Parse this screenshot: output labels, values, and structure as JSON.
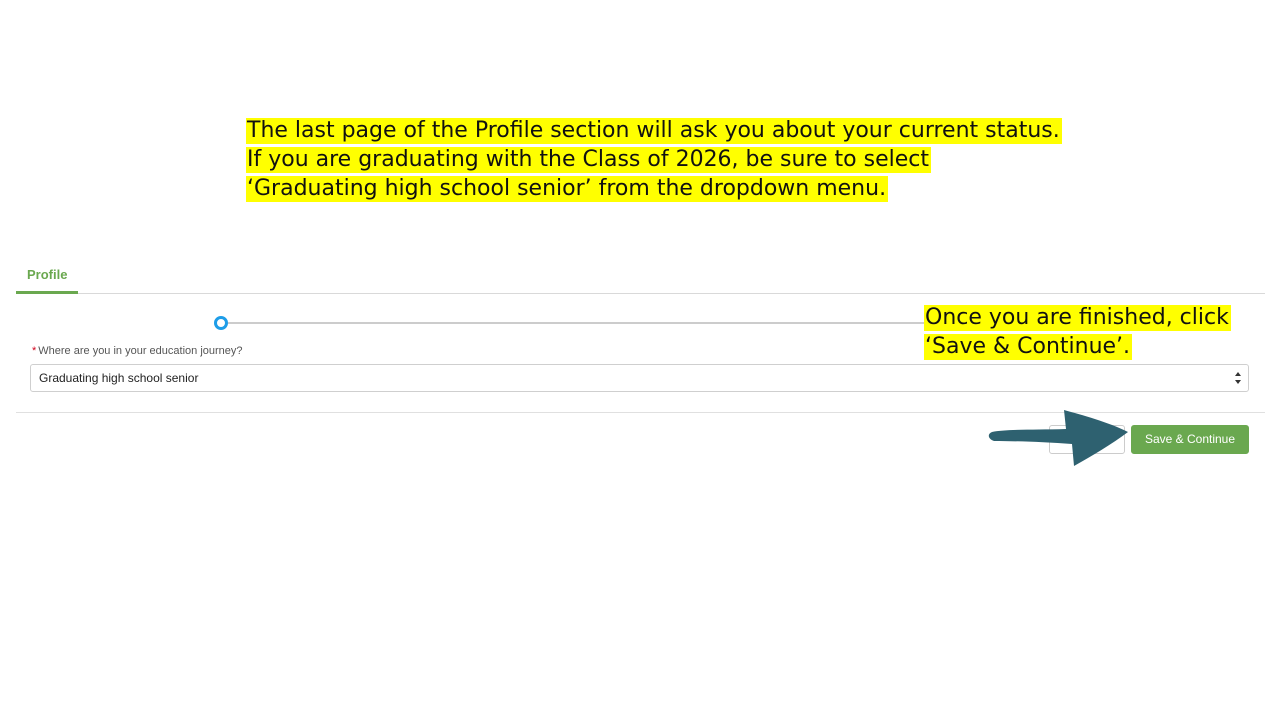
{
  "annotations": {
    "intro": "The last page of the Profile section will ask you about your current status. If you are graduating with the Class of 2026, be sure to select ‘Graduating high school senior’ from the dropdown menu.",
    "finish": "Once you are finished, click ‘Save & Continue’."
  },
  "tabs": [
    {
      "label": "Profile",
      "active": true
    }
  ],
  "progress": {
    "current_step": 1
  },
  "form": {
    "education_journey": {
      "required_marker": "*",
      "label": "Where are you in your education journey?",
      "selected_value": "Graduating high school senior"
    }
  },
  "actions": {
    "previous_label": "Previous",
    "save_label": "Save & Continue"
  },
  "colors": {
    "highlight": "#ffff00",
    "accent_green": "#6aa84f",
    "step_blue": "#1e9de8",
    "arrow_teal": "#2e6170",
    "required_red": "#d0021b"
  },
  "icons": {
    "step": "step-indicator-icon",
    "select_arrows": "updown-chevrons-icon",
    "pointer": "arrow-right-icon"
  }
}
